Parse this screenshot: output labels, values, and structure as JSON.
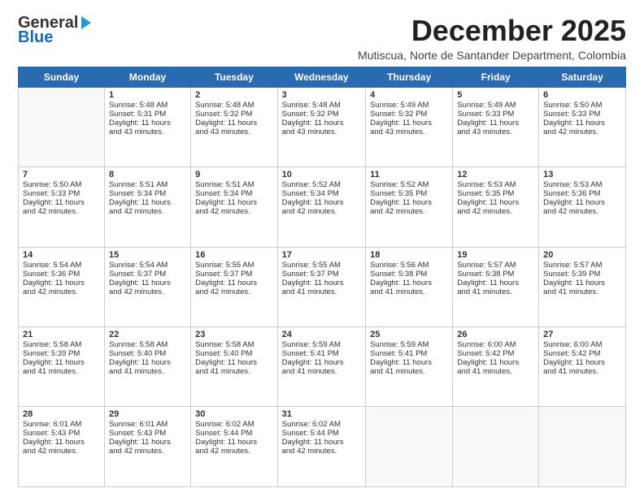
{
  "logo": {
    "line1": "General",
    "line2": "Blue"
  },
  "title": "December 2025",
  "location": "Mutiscua, Norte de Santander Department, Colombia",
  "days_of_week": [
    "Sunday",
    "Monday",
    "Tuesday",
    "Wednesday",
    "Thursday",
    "Friday",
    "Saturday"
  ],
  "weeks": [
    [
      {
        "day": "",
        "info": ""
      },
      {
        "day": "1",
        "info": "Sunrise: 5:48 AM\nSunset: 5:31 PM\nDaylight: 11 hours\nand 43 minutes."
      },
      {
        "day": "2",
        "info": "Sunrise: 5:48 AM\nSunset: 5:32 PM\nDaylight: 11 hours\nand 43 minutes."
      },
      {
        "day": "3",
        "info": "Sunrise: 5:48 AM\nSunset: 5:32 PM\nDaylight: 11 hours\nand 43 minutes."
      },
      {
        "day": "4",
        "info": "Sunrise: 5:49 AM\nSunset: 5:32 PM\nDaylight: 11 hours\nand 43 minutes."
      },
      {
        "day": "5",
        "info": "Sunrise: 5:49 AM\nSunset: 5:33 PM\nDaylight: 11 hours\nand 43 minutes."
      },
      {
        "day": "6",
        "info": "Sunrise: 5:50 AM\nSunset: 5:33 PM\nDaylight: 11 hours\nand 42 minutes."
      }
    ],
    [
      {
        "day": "7",
        "info": "Sunrise: 5:50 AM\nSunset: 5:33 PM\nDaylight: 11 hours\nand 42 minutes."
      },
      {
        "day": "8",
        "info": "Sunrise: 5:51 AM\nSunset: 5:34 PM\nDaylight: 11 hours\nand 42 minutes."
      },
      {
        "day": "9",
        "info": "Sunrise: 5:51 AM\nSunset: 5:34 PM\nDaylight: 11 hours\nand 42 minutes."
      },
      {
        "day": "10",
        "info": "Sunrise: 5:52 AM\nSunset: 5:34 PM\nDaylight: 11 hours\nand 42 minutes."
      },
      {
        "day": "11",
        "info": "Sunrise: 5:52 AM\nSunset: 5:35 PM\nDaylight: 11 hours\nand 42 minutes."
      },
      {
        "day": "12",
        "info": "Sunrise: 5:53 AM\nSunset: 5:35 PM\nDaylight: 11 hours\nand 42 minutes."
      },
      {
        "day": "13",
        "info": "Sunrise: 5:53 AM\nSunset: 5:36 PM\nDaylight: 11 hours\nand 42 minutes."
      }
    ],
    [
      {
        "day": "14",
        "info": "Sunrise: 5:54 AM\nSunset: 5:36 PM\nDaylight: 11 hours\nand 42 minutes."
      },
      {
        "day": "15",
        "info": "Sunrise: 5:54 AM\nSunset: 5:37 PM\nDaylight: 11 hours\nand 42 minutes."
      },
      {
        "day": "16",
        "info": "Sunrise: 5:55 AM\nSunset: 5:37 PM\nDaylight: 11 hours\nand 42 minutes."
      },
      {
        "day": "17",
        "info": "Sunrise: 5:55 AM\nSunset: 5:37 PM\nDaylight: 11 hours\nand 41 minutes."
      },
      {
        "day": "18",
        "info": "Sunrise: 5:56 AM\nSunset: 5:38 PM\nDaylight: 11 hours\nand 41 minutes."
      },
      {
        "day": "19",
        "info": "Sunrise: 5:57 AM\nSunset: 5:38 PM\nDaylight: 11 hours\nand 41 minutes."
      },
      {
        "day": "20",
        "info": "Sunrise: 5:57 AM\nSunset: 5:39 PM\nDaylight: 11 hours\nand 41 minutes."
      }
    ],
    [
      {
        "day": "21",
        "info": "Sunrise: 5:58 AM\nSunset: 5:39 PM\nDaylight: 11 hours\nand 41 minutes."
      },
      {
        "day": "22",
        "info": "Sunrise: 5:58 AM\nSunset: 5:40 PM\nDaylight: 11 hours\nand 41 minutes."
      },
      {
        "day": "23",
        "info": "Sunrise: 5:58 AM\nSunset: 5:40 PM\nDaylight: 11 hours\nand 41 minutes."
      },
      {
        "day": "24",
        "info": "Sunrise: 5:59 AM\nSunset: 5:41 PM\nDaylight: 11 hours\nand 41 minutes."
      },
      {
        "day": "25",
        "info": "Sunrise: 5:59 AM\nSunset: 5:41 PM\nDaylight: 11 hours\nand 41 minutes."
      },
      {
        "day": "26",
        "info": "Sunrise: 6:00 AM\nSunset: 5:42 PM\nDaylight: 11 hours\nand 41 minutes."
      },
      {
        "day": "27",
        "info": "Sunrise: 6:00 AM\nSunset: 5:42 PM\nDaylight: 11 hours\nand 41 minutes."
      }
    ],
    [
      {
        "day": "28",
        "info": "Sunrise: 6:01 AM\nSunset: 5:43 PM\nDaylight: 11 hours\nand 42 minutes."
      },
      {
        "day": "29",
        "info": "Sunrise: 6:01 AM\nSunset: 5:43 PM\nDaylight: 11 hours\nand 42 minutes."
      },
      {
        "day": "30",
        "info": "Sunrise: 6:02 AM\nSunset: 5:44 PM\nDaylight: 11 hours\nand 42 minutes."
      },
      {
        "day": "31",
        "info": "Sunrise: 6:02 AM\nSunset: 5:44 PM\nDaylight: 11 hours\nand 42 minutes."
      },
      {
        "day": "",
        "info": ""
      },
      {
        "day": "",
        "info": ""
      },
      {
        "day": "",
        "info": ""
      }
    ]
  ]
}
